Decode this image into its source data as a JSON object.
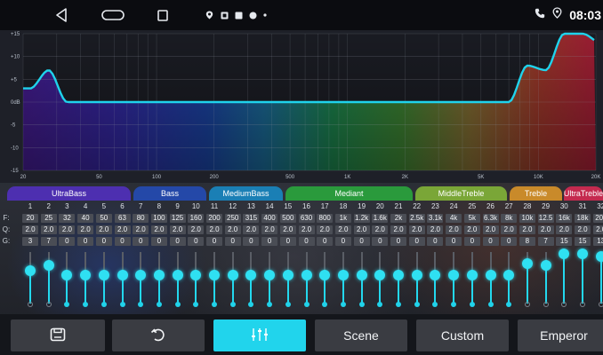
{
  "status_bar": {
    "clock": "08:03",
    "nav_icons": [
      "back-icon",
      "home-icon",
      "recents-icon"
    ],
    "notification_icons": [
      "location-icon",
      "notification-square-icon",
      "notification-square-icon",
      "notification-circle-icon",
      "notification-dot-icon"
    ],
    "right_icons": [
      "phone-icon",
      "location-icon"
    ]
  },
  "graph": {
    "y_ticks": [
      "+15",
      "+10",
      "+5",
      "0dB",
      "-5",
      "-10",
      "-15"
    ],
    "x_ticks": [
      "20",
      "50",
      "100",
      "200",
      "500",
      "1K",
      "2K",
      "5K",
      "10K",
      "20K"
    ],
    "curve_color": "#1fd3ec"
  },
  "bands": [
    {
      "label": "UltraBass",
      "color": "#4d2fb0"
    },
    {
      "label": "Bass",
      "color": "#2448a8"
    },
    {
      "label": "MediumBass",
      "color": "#1a7fb5"
    },
    {
      "label": "Mediant",
      "color": "#2a9a3c"
    },
    {
      "label": "MiddleTreble",
      "color": "#7aa637"
    },
    {
      "label": "Treble",
      "color": "#c98a2a"
    },
    {
      "label": "UltraTreble",
      "color": "#c42a4f"
    }
  ],
  "table": {
    "row_labels": {
      "f": "F:",
      "q": "Q:",
      "g": "G:"
    },
    "numbers": [
      "1",
      "2",
      "3",
      "4",
      "5",
      "6",
      "7",
      "8",
      "9",
      "10",
      "11",
      "12",
      "13",
      "14",
      "15",
      "16",
      "17",
      "18",
      "19",
      "20",
      "21",
      "22",
      "23",
      "24",
      "25",
      "26",
      "27",
      "28",
      "29",
      "30",
      "31",
      "32"
    ],
    "frequencies": [
      "20",
      "25",
      "32",
      "40",
      "50",
      "63",
      "80",
      "100",
      "125",
      "160",
      "200",
      "250",
      "315",
      "400",
      "500",
      "630",
      "800",
      "1k",
      "1.2k",
      "1.6k",
      "2k",
      "2.5k",
      "3.1k",
      "4k",
      "5k",
      "6.3k",
      "8k",
      "10k",
      "12.5",
      "16k",
      "18k",
      "20k"
    ],
    "q": [
      "2.0",
      "2.0",
      "2.0",
      "2.0",
      "2.0",
      "2.0",
      "2.0",
      "2.0",
      "2.0",
      "2.0",
      "2.0",
      "2.0",
      "2.0",
      "2.0",
      "2.0",
      "2.0",
      "2.0",
      "2.0",
      "2.0",
      "2.0",
      "2.0",
      "2.0",
      "2.0",
      "2.0",
      "2.0",
      "2.0",
      "2.0",
      "2.0",
      "2.0",
      "2.0",
      "2.0",
      "2.0"
    ],
    "gain": [
      "3",
      "7",
      "0",
      "0",
      "0",
      "0",
      "0",
      "0",
      "0",
      "0",
      "0",
      "0",
      "0",
      "0",
      "0",
      "0",
      "0",
      "0",
      "0",
      "0",
      "0",
      "0",
      "0",
      "0",
      "0",
      "0",
      "0",
      "8",
      "7",
      "15",
      "15",
      "13"
    ]
  },
  "sliders": {
    "gain_min": -15,
    "gain_max": 15,
    "enabled": [
      false,
      false,
      true,
      true,
      true,
      true,
      true,
      true,
      true,
      true,
      true,
      true,
      true,
      true,
      true,
      true,
      true,
      true,
      true,
      true,
      true,
      true,
      true,
      true,
      true,
      true,
      true,
      false,
      false,
      false,
      false,
      false
    ]
  },
  "toolbar": {
    "save_icon": "save-icon",
    "reset_icon": "reset-icon",
    "eq_icon": "equalizer-icon",
    "scene_label": "Scene",
    "custom_label": "Custom",
    "emperor_label": "Emperor"
  }
}
